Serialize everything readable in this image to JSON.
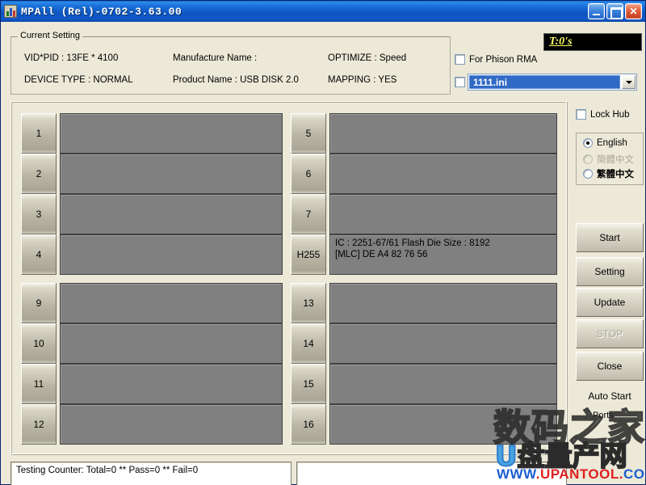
{
  "window": {
    "title": "MPAll (Rel)-0702-3.63.00",
    "icon": "app-icon",
    "minimize_label": "",
    "maximize_label": "",
    "close_label": "✕"
  },
  "current_setting": {
    "legend": "Current Setting",
    "vid_pid": "VID*PID : 13FE * 4100",
    "device_type": "DEVICE TYPE : NORMAL",
    "manufacture_name": "Manufacture Name :",
    "product_name": "Product Name : USB DISK 2.0",
    "optimize": "OPTIMIZE : Speed",
    "mapping": "MAPPING : YES"
  },
  "top_right": {
    "timer_badge": "T:0's",
    "phison_rma_label": "For Phison RMA",
    "ini_selected": "1111.ini",
    "ini_options": [
      "1111.ini"
    ]
  },
  "sidebar": {
    "lock_hub_label": "Lock Hub",
    "languages": [
      {
        "label": "English",
        "selected": true,
        "disabled": false
      },
      {
        "label": "簡體中文",
        "selected": false,
        "disabled": true
      },
      {
        "label": "繁體中文",
        "selected": false,
        "disabled": false
      }
    ],
    "buttons": [
      {
        "label": "Start",
        "disabled": false
      },
      {
        "label": "Setting",
        "disabled": false
      },
      {
        "label": "Update",
        "disabled": false
      },
      {
        "label": "STOP",
        "disabled": true
      },
      {
        "label": "Close",
        "disabled": false
      }
    ],
    "auto_start_label": "Auto Start",
    "ports_label": "Ports"
  },
  "ports": {
    "left": [
      {
        "id": "1",
        "status": ""
      },
      {
        "id": "2",
        "status": ""
      },
      {
        "id": "3",
        "status": ""
      },
      {
        "id": "4",
        "status": ""
      },
      {
        "id": "9",
        "status": ""
      },
      {
        "id": "10",
        "status": ""
      },
      {
        "id": "11",
        "status": ""
      },
      {
        "id": "12",
        "status": ""
      }
    ],
    "right": [
      {
        "id": "5",
        "status": ""
      },
      {
        "id": "6",
        "status": ""
      },
      {
        "id": "7",
        "status": ""
      },
      {
        "id": "H255",
        "status": "IC : 2251-67/61  Flash Die Size : 8192\n[MLC] DE A4 82 76 56"
      },
      {
        "id": "13",
        "status": ""
      },
      {
        "id": "14",
        "status": ""
      },
      {
        "id": "15",
        "status": ""
      },
      {
        "id": "16",
        "status": ""
      }
    ]
  },
  "bottom": {
    "counter_text": "Testing Counter: Total=0 ** Pass=0 ** Fail=0",
    "log_text": ""
  },
  "watermark": {
    "line1": "数码之家",
    "line2_prefix": "U",
    "line2": "盘量产网",
    "url_prefix": "WWW",
    "url_dot1": ".",
    "url_mid": "UPANTOOL",
    "url_dot2": ".",
    "url_suffix": "COM"
  },
  "colors": {
    "titlebar_blue": "#0d55c0",
    "face": "#ece9d8",
    "port_status_gray": "#808080",
    "badge_yellow": "#ffff66",
    "combo_highlight": "#316ac5"
  }
}
